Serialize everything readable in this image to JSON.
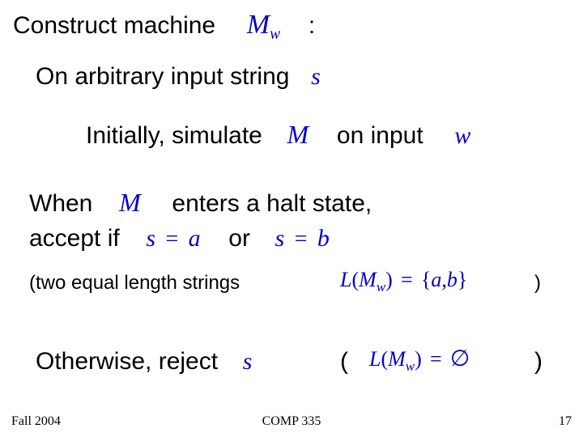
{
  "title_prefix": "Construct machine",
  "sym_Mw_M": "M",
  "sym_Mw_w": "w",
  "colon": ":",
  "line_onarb": "On arbitrary input string",
  "sym_s": "s",
  "line_init": "Initially, simulate",
  "sym_M": "M",
  "txt_oninput": "on input",
  "sym_w": "w",
  "txt_when": "When",
  "txt_enters": "enters a halt state,",
  "txt_acceptif": "accept if",
  "eq_sa_lhs": "s",
  "eq_eq": "=",
  "eq_sa_rhs": "a",
  "txt_or": "or",
  "eq_sb_lhs": "s",
  "eq_sb_rhs": "b",
  "txt_twoeq": "(two equal length strings",
  "sym_L": "L",
  "lparen": "(",
  "rparen": ")",
  "set_open": "{",
  "set_a": "a",
  "set_comma": ",",
  "set_b": "b",
  "set_close": "}",
  "txt_otherwise": "Otherwise, reject",
  "sym_empty": "∅",
  "footer_left": "Fall 2004",
  "footer_center": "COMP 335",
  "footer_right": "17"
}
